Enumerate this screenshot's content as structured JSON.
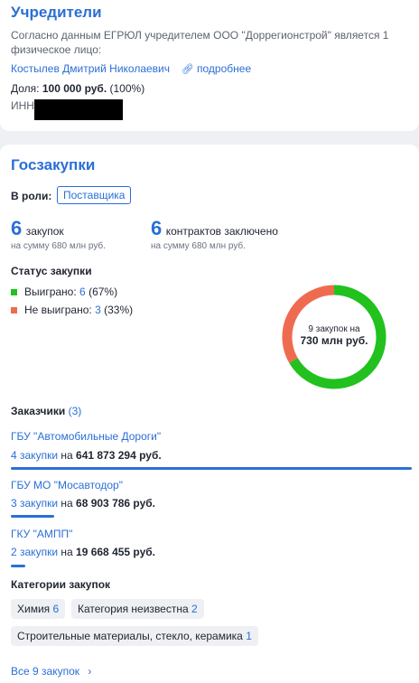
{
  "founders": {
    "title": "Учредители",
    "description": "Согласно данным ЕГРЮЛ учредителем ООО \"Доррегионстрой\" является 1 физическое лицо:",
    "person_name": "Костылев Дмитрий Николаевич",
    "details_link": "подробнее",
    "share_label": "Доля:",
    "share_value": "100 000 руб.",
    "share_percent": "(100%)",
    "inn_label": "ИНН:"
  },
  "procurement": {
    "title": "Госзакупки",
    "role_label": "В роли:",
    "role_value": "Поставщика",
    "purchases_count": "6",
    "purchases_label": "закупок",
    "purchases_sum": "на сумму 680 млн руб.",
    "contracts_count": "6",
    "contracts_label": "контрактов заключено",
    "contracts_sum": "на сумму 680 млн руб.",
    "status_title": "Статус закупки",
    "won_label": "Выиграно:",
    "won_count": "6",
    "won_percent": "(67%)",
    "lost_label": "Не выиграно:",
    "lost_count": "3",
    "lost_percent": "(33%)",
    "donut_line1": "9 закупок на",
    "donut_line2": "730 млн руб.",
    "colors": {
      "won": "#22c11e",
      "lost": "#ef6b4f",
      "accent": "#2a6fd6"
    },
    "customers_title": "Заказчики",
    "customers_count": "(3)",
    "customers": [
      {
        "name": "ГБУ \"Автомобильные Дороги\"",
        "count_text": "4 закупки",
        "on": "на",
        "amount": "641 873 294 руб.",
        "share": 1.0
      },
      {
        "name": "ГБУ МО \"Мосавтодор\"",
        "count_text": "3 закупки",
        "on": "на",
        "amount": "68 903 786 руб.",
        "share": 0.107
      },
      {
        "name": "ГКУ \"АМПП\"",
        "count_text": "2 закупки",
        "on": "на",
        "amount": "19 668 455 руб.",
        "share": 0.031
      }
    ],
    "categories_title": "Категории закупок",
    "categories": [
      {
        "label": "Химия",
        "count": "6"
      },
      {
        "label": "Категория неизвестна",
        "count": "2"
      },
      {
        "label": "Строительные материалы, стекло, керамика",
        "count": "1"
      }
    ],
    "all_link": "Все 9 закупок",
    "all_link_arrow": "›"
  },
  "chart_data": {
    "type": "pie",
    "categories": [
      "Выиграно",
      "Не выиграно"
    ],
    "values": [
      6,
      3
    ]
  }
}
